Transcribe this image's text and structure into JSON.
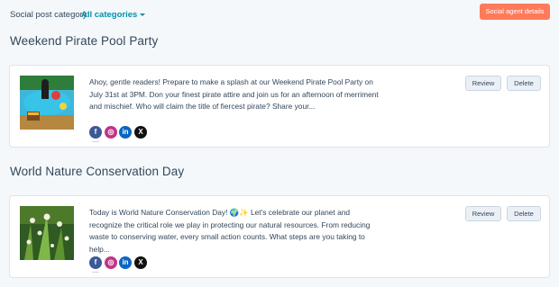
{
  "filter": {
    "label": "Social post category:",
    "value": "All categories"
  },
  "agent_button": "Social agent details",
  "posts": [
    {
      "title": "Weekend Pirate Pool Party",
      "text": "Ahoy, gentle readers! Prepare to make a splash at our Weekend Pirate Pool Party on July 31st at 3PM. Don your finest pirate attire and join us for an afternoon of merriment and mischief. Who will claim the title of fiercest pirate? Share your...",
      "networks": [
        "f",
        "◎",
        "in",
        "X"
      ],
      "review_label": "Review",
      "delete_label": "Delete"
    },
    {
      "title": "World Nature Conservation Day",
      "text": "Today is World Nature Conservation Day! 🌍✨ Let's celebrate our planet and recognize the critical role we play in protecting our natural resources. From reducing waste to conserving water, every small action counts. What steps are you taking to help...",
      "networks": [
        "f",
        "◎",
        "in",
        "X"
      ],
      "review_label": "Review",
      "delete_label": "Delete"
    }
  ],
  "colors": {
    "accent": "#0091ae",
    "primary_button": "#ff7a59",
    "facebook": "#3b5998",
    "instagram": "#c13584",
    "linkedin": "#0a66c2",
    "x": "#111111"
  }
}
